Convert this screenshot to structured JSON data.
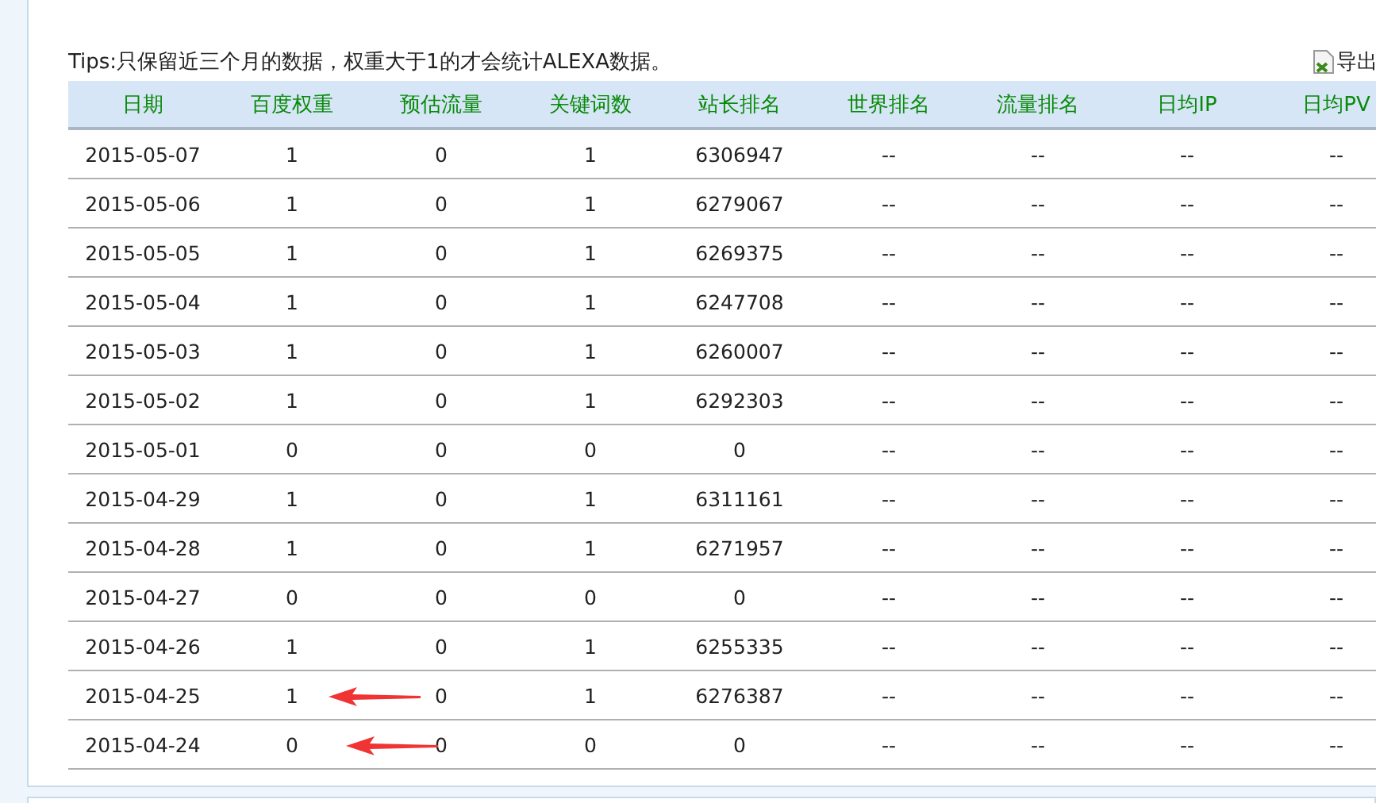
{
  "tips": "Tips:只保留近三个月的数据，权重大于1的才会统计ALEXA数据。",
  "export_link": "导出",
  "table": {
    "columns": [
      "日期",
      "百度权重",
      "预估流量",
      "关键词数",
      "站长排名",
      "世界排名",
      "流量排名",
      "日均IP",
      "日均PV"
    ],
    "rows": [
      {
        "cells": [
          "2015-05-07",
          "1",
          "0",
          "1",
          "6306947",
          "--",
          "--",
          "--",
          "--"
        ],
        "marked": false
      },
      {
        "cells": [
          "2015-05-06",
          "1",
          "0",
          "1",
          "6279067",
          "--",
          "--",
          "--",
          "--"
        ],
        "marked": false
      },
      {
        "cells": [
          "2015-05-05",
          "1",
          "0",
          "1",
          "6269375",
          "--",
          "--",
          "--",
          "--"
        ],
        "marked": false
      },
      {
        "cells": [
          "2015-05-04",
          "1",
          "0",
          "1",
          "6247708",
          "--",
          "--",
          "--",
          "--"
        ],
        "marked": false
      },
      {
        "cells": [
          "2015-05-03",
          "1",
          "0",
          "1",
          "6260007",
          "--",
          "--",
          "--",
          "--"
        ],
        "marked": false
      },
      {
        "cells": [
          "2015-05-02",
          "1",
          "0",
          "1",
          "6292303",
          "--",
          "--",
          "--",
          "--"
        ],
        "marked": false
      },
      {
        "cells": [
          "2015-05-01",
          "0",
          "0",
          "0",
          "0",
          "--",
          "--",
          "--",
          "--"
        ],
        "marked": false
      },
      {
        "cells": [
          "2015-04-29",
          "1",
          "0",
          "1",
          "6311161",
          "--",
          "--",
          "--",
          "--"
        ],
        "marked": false
      },
      {
        "cells": [
          "2015-04-28",
          "1",
          "0",
          "1",
          "6271957",
          "--",
          "--",
          "--",
          "--"
        ],
        "marked": false
      },
      {
        "cells": [
          "2015-04-27",
          "0",
          "0",
          "0",
          "0",
          "--",
          "--",
          "--",
          "--"
        ],
        "marked": false
      },
      {
        "cells": [
          "2015-04-26",
          "1",
          "0",
          "1",
          "6255335",
          "--",
          "--",
          "--",
          "--"
        ],
        "marked": false
      },
      {
        "cells": [
          "2015-04-25",
          "1",
          "0",
          "1",
          "6276387",
          "--",
          "--",
          "--",
          "--"
        ],
        "marked": true
      },
      {
        "cells": [
          "2015-04-24",
          "0",
          "0",
          "0",
          "0",
          "--",
          "--",
          "--",
          "--"
        ],
        "marked": true
      }
    ]
  }
}
